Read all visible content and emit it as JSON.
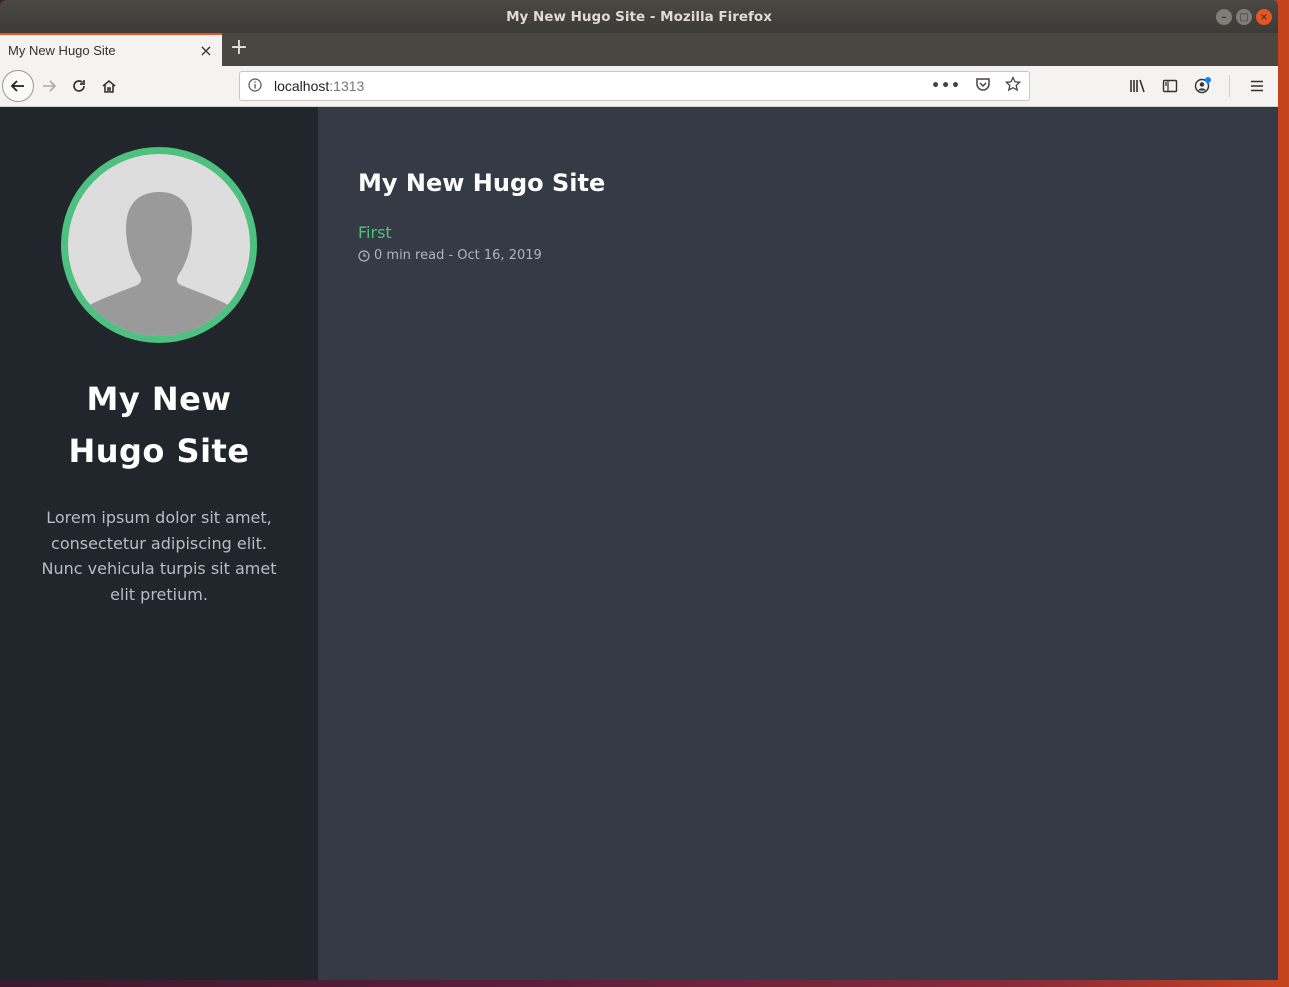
{
  "window": {
    "title": "My New Hugo Site - Mozilla Firefox"
  },
  "tabs": [
    {
      "label": "My New Hugo Site"
    }
  ],
  "urlbar": {
    "host": "localhost",
    "port": ":1313"
  },
  "sidebar": {
    "site_title": "My New Hugo Site",
    "description": "Lorem ipsum dolor sit amet, consectetur adipiscing elit. Nunc vehicula turpis sit amet elit pretium."
  },
  "main": {
    "title": "My New Hugo Site",
    "posts": [
      {
        "title": "First",
        "meta": "0 min read - Oct 16, 2019"
      }
    ]
  },
  "colors": {
    "accent": "#4ec07f",
    "sidebar_bg": "#21252c",
    "main_bg": "#353b44",
    "ubuntu_orange": "#e95420"
  },
  "icons": {
    "back": "arrow-left-icon",
    "forward": "arrow-right-icon",
    "reload": "reload-icon",
    "home": "home-icon",
    "info": "info-icon",
    "more": "ellipsis-icon",
    "pocket": "pocket-icon",
    "bookmark": "star-icon",
    "library": "library-icon",
    "sidebar": "sidebar-icon",
    "account": "account-icon",
    "menu": "hamburger-menu-icon",
    "clock": "clock-icon"
  }
}
